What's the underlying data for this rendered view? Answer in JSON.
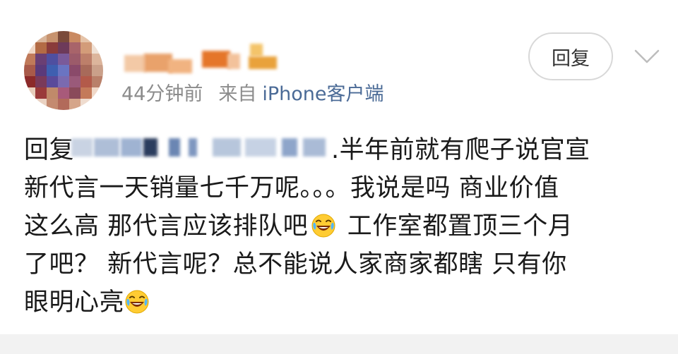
{
  "comment": {
    "meta": {
      "time": "44分钟前",
      "from_label": "来自",
      "device": "iPhone客户端"
    },
    "actions": {
      "reply_label": "回复"
    },
    "body": {
      "line_1_prefix": "回复",
      "line_1_suffix": ".半年前就有爬子说官宣",
      "line_2": "新代言一天销量七千万呢。。。我说是吗 商业价值",
      "line_3_a": "这么高 那代言应该排队吧",
      "line_3_b": " 工作室都置顶三个月",
      "line_4": "了吧？ 新代言呢？总不能说人家商家都瞎 只有你",
      "line_5": "眼明心亮"
    },
    "emoji": "laughing-crying",
    "colors": {
      "device_link": "#4a6a96",
      "meta_text": "#8c8c8c",
      "body_text": "#1a1a1a"
    }
  }
}
